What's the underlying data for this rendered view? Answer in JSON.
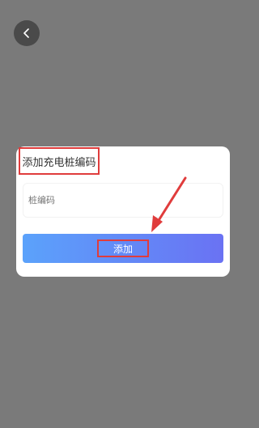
{
  "nav": {
    "back_icon": "chevron-left-icon"
  },
  "dialog": {
    "title": "添加充电桩编码",
    "code_input": {
      "placeholder": "桩编码",
      "value": ""
    },
    "add_button_label": "添加"
  },
  "colors": {
    "overlay": "#7a7a7a",
    "highlight": "#e03c3c",
    "button_gradient_start": "#5ba2fb",
    "button_gradient_end": "#6a72f3"
  }
}
